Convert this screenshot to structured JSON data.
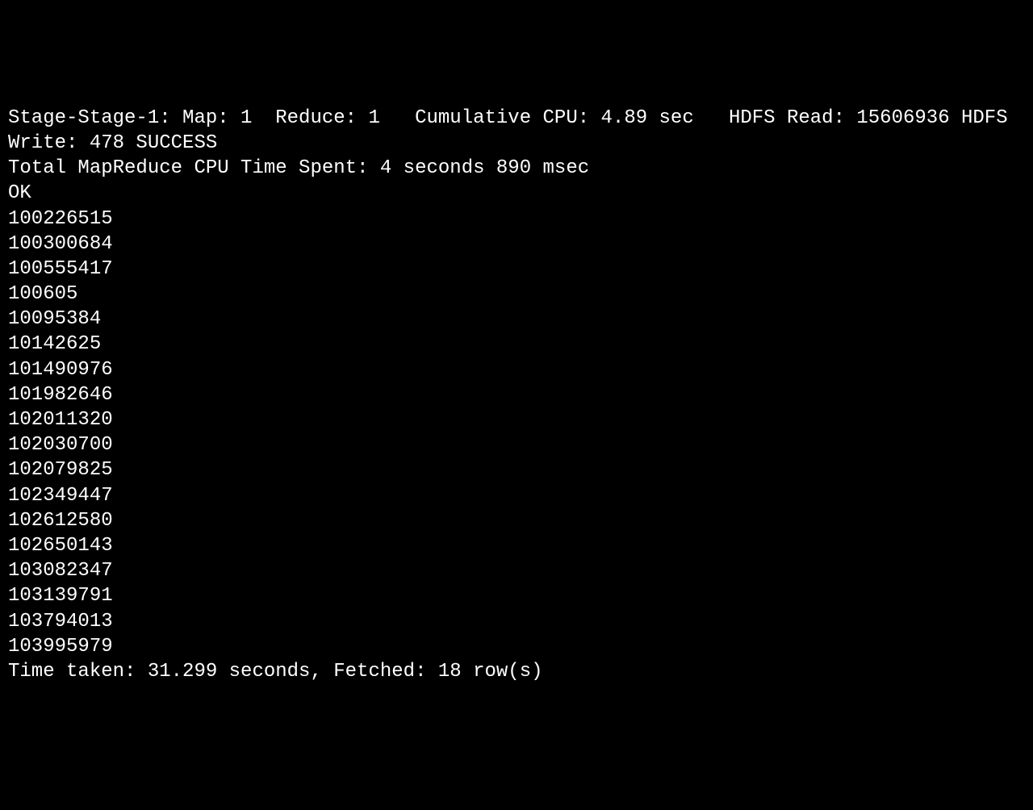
{
  "terminal": {
    "stage_line": "Stage-Stage-1: Map: 1  Reduce: 1   Cumulative CPU: 4.89 sec   HDFS Read: 15606936 HDFS Write: 478 SUCCESS",
    "cpu_time_line": "Total MapReduce CPU Time Spent: 4 seconds 890 msec",
    "ok_line": "OK",
    "results": [
      "100226515",
      "100300684",
      "100555417",
      "100605",
      "10095384",
      "10142625",
      "101490976",
      "101982646",
      "102011320",
      "102030700",
      "102079825",
      "102349447",
      "102612580",
      "102650143",
      "103082347",
      "103139791",
      "103794013",
      "103995979"
    ],
    "time_taken_line": "Time taken: 31.299 seconds, Fetched: 18 row(s)"
  }
}
